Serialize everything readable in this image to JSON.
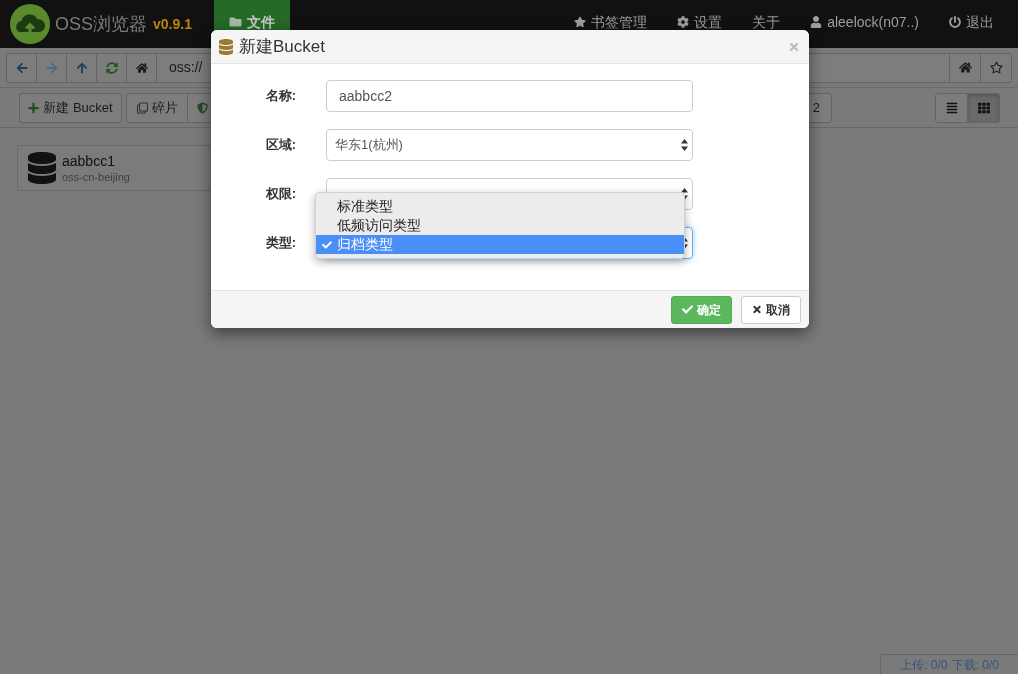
{
  "navbar": {
    "brand": "OSS浏览器",
    "version": "v0.9.1",
    "tabs": [
      {
        "label": "文件",
        "selected": true
      }
    ],
    "menu": [
      {
        "kind": "bookmarks",
        "label": "书签管理"
      },
      {
        "kind": "settings",
        "label": "设置"
      },
      {
        "kind": "about",
        "label": "关于"
      },
      {
        "kind": "user",
        "label": "aleelock(n07..)"
      },
      {
        "kind": "logout",
        "label": "退出"
      }
    ]
  },
  "address_bar": {
    "nav_buttons": [
      {
        "kind": "back",
        "disabled": false
      },
      {
        "kind": "forward",
        "disabled": true
      },
      {
        "kind": "up",
        "disabled": false
      },
      {
        "kind": "refresh",
        "disabled": false
      },
      {
        "kind": "home",
        "disabled": false
      }
    ],
    "path": "oss://",
    "side_buttons": [
      {
        "kind": "home"
      },
      {
        "kind": "bookmark"
      }
    ]
  },
  "toolbar": {
    "actions": [
      {
        "kind": "create",
        "label": "新建 Bucket"
      },
      {
        "kind": "fragments",
        "label": "碎片"
      },
      {
        "kind": "permissions"
      }
    ],
    "button_4": {
      "label": "2"
    },
    "view_buttons": [
      {
        "kind": "list",
        "selected": false
      },
      {
        "kind": "grid",
        "selected": true
      }
    ]
  },
  "buckets": [
    {
      "name": "aabbcc1",
      "region": "oss-cn-beijing"
    }
  ],
  "dialog": {
    "title": "新建Bucket",
    "fields": [
      {
        "kind": "input",
        "label": "名称:",
        "value": "aabbcc2",
        "focused": false
      },
      {
        "kind": "select",
        "label": "区域:",
        "value": "华东1(杭州)",
        "focused": false
      },
      {
        "kind": "select",
        "label": "权限:",
        "focused": false
      },
      {
        "kind": "select",
        "label": "类型:",
        "focused": true,
        "options": [
          {
            "label": "标准类型",
            "selected": false
          },
          {
            "label": "低频访问类型",
            "selected": false
          },
          {
            "label": "归档类型",
            "selected": true
          }
        ]
      }
    ],
    "buttons": [
      {
        "kind": "primary",
        "label": "确定"
      },
      {
        "kind": "default",
        "label": "取消"
      }
    ]
  },
  "status_bar": {
    "upload": "上传: 0/0",
    "download": "下载: 0/0"
  }
}
